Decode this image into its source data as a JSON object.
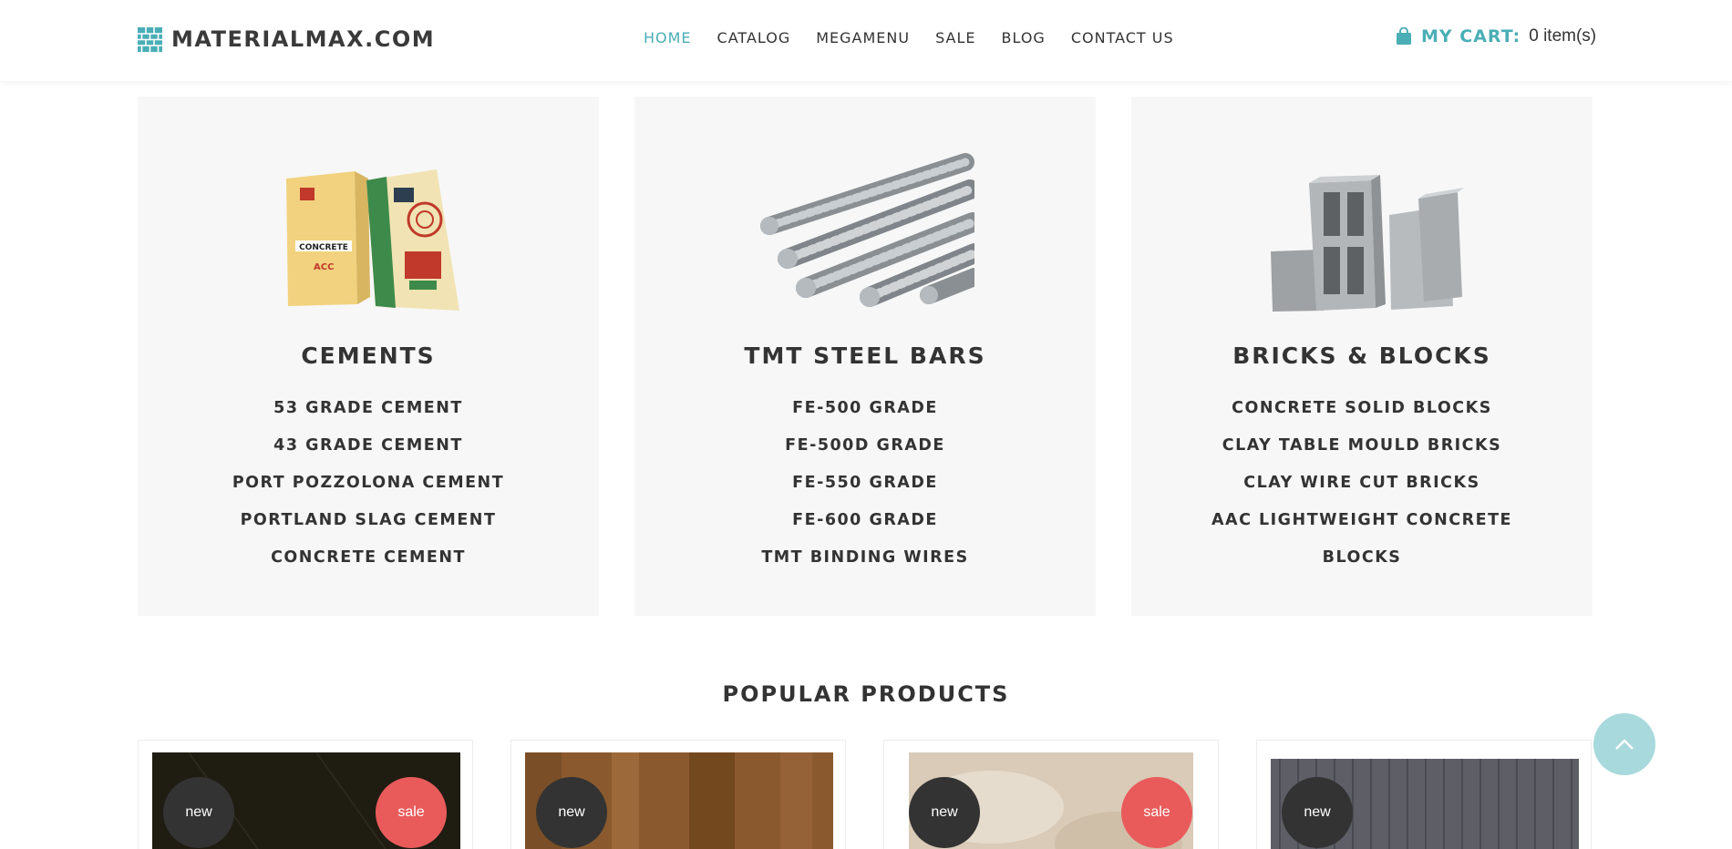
{
  "brand": {
    "logo_text": "MATERIALMAX.COM",
    "logo_icon": "brick-wall-icon",
    "accent_color": "#4aaeb6"
  },
  "nav": {
    "items": [
      {
        "label": "HOME",
        "active": true
      },
      {
        "label": "CATALOG",
        "active": false
      },
      {
        "label": "MEGAMENU",
        "active": false
      },
      {
        "label": "SALE",
        "active": false
      },
      {
        "label": "BLOG",
        "active": false
      },
      {
        "label": "CONTACT US",
        "active": false
      }
    ]
  },
  "cart": {
    "icon": "shopping-bag-icon",
    "label": "MY CART:",
    "count_text": "0 item(s)"
  },
  "categories": [
    {
      "title": "CEMENTS",
      "image": "cement-bags",
      "items": [
        "53 GRADE CEMENT",
        "43 GRADE CEMENT",
        "PORT POZZOLONA CEMENT",
        "PORTLAND SLAG CEMENT",
        "CONCRETE CEMENT"
      ]
    },
    {
      "title": "TMT STEEL BARS",
      "image": "steel-rebars",
      "items": [
        "FE-500 GRADE",
        "FE-500D GRADE",
        "FE-550 GRADE",
        "FE-600 GRADE",
        "TMT BINDING WIRES"
      ]
    },
    {
      "title": "BRICKS & BLOCKS",
      "image": "concrete-blocks",
      "items": [
        "CONCRETE SOLID BLOCKS",
        "CLAY TABLE MOULD BRICKS",
        "CLAY WIRE CUT BRICKS",
        "AAC LIGHTWEIGHT CONCRETE",
        "BLOCKS"
      ]
    }
  ],
  "popular": {
    "title": "POPULAR PRODUCTS",
    "products": [
      {
        "image": "dark-tile",
        "badges": [
          "new",
          "sale"
        ]
      },
      {
        "image": "wood-plank",
        "badges": [
          "new"
        ]
      },
      {
        "image": "beige-marble",
        "badges": [
          "new",
          "sale"
        ]
      },
      {
        "image": "grey-carpet",
        "badges": [
          "new"
        ]
      }
    ]
  },
  "scroll_top": {
    "icon": "chevron-up-icon"
  }
}
